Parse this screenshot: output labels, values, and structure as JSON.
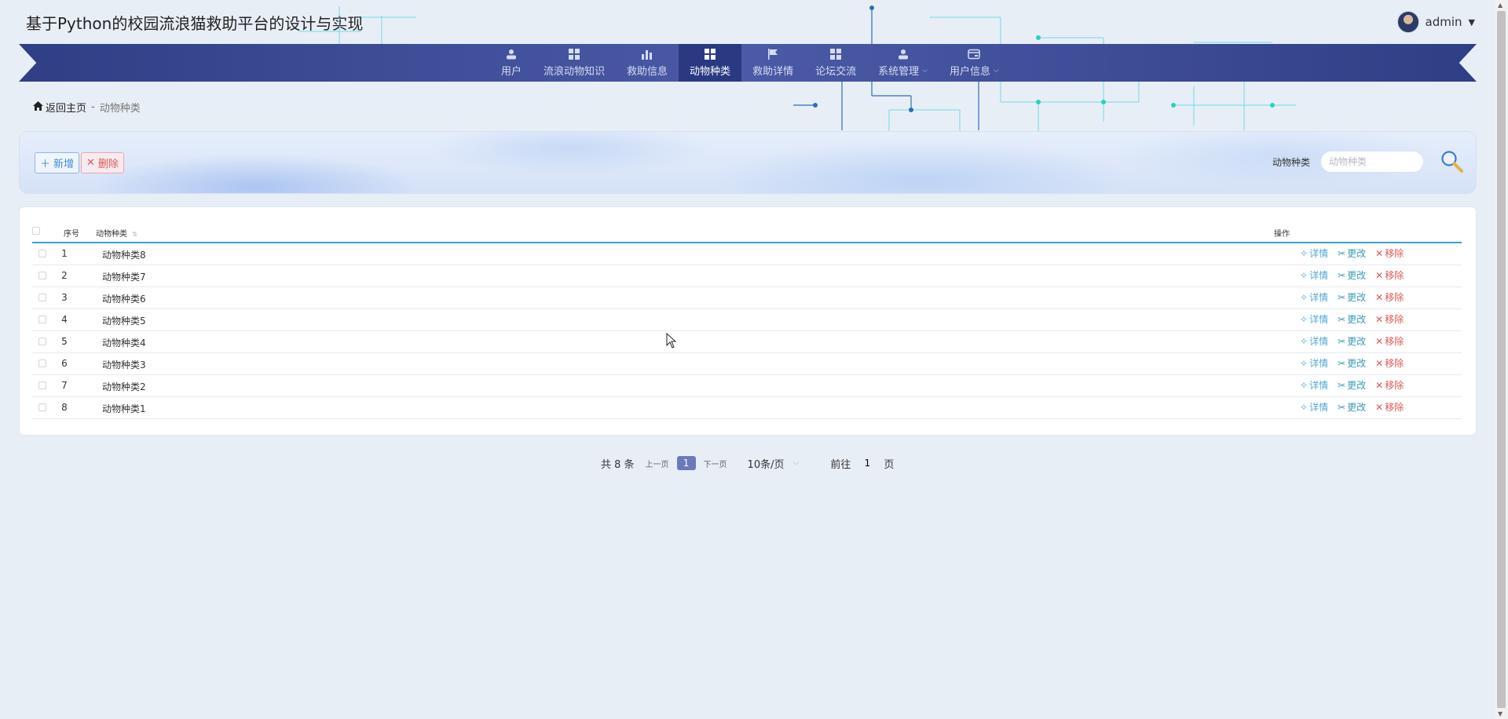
{
  "header": {
    "site_title": "基于Python的校园流浪猫救助平台的设计与实现",
    "username": "admin"
  },
  "nav": {
    "items": [
      {
        "label": "用户",
        "icon": "user-icon"
      },
      {
        "label": "流浪动物知识",
        "icon": "grid-icon"
      },
      {
        "label": "救助信息",
        "icon": "bar-chart-icon"
      },
      {
        "label": "动物种类",
        "icon": "grid-icon",
        "active": true
      },
      {
        "label": "救助详情",
        "icon": "flag-icon"
      },
      {
        "label": "论坛交流",
        "icon": "grid-icon"
      },
      {
        "label": "系统管理",
        "icon": "user-icon",
        "dropdown": true
      },
      {
        "label": "用户信息",
        "icon": "card-icon",
        "dropdown": true
      }
    ]
  },
  "breadcrumb": {
    "home": "返回主页",
    "separator": "-",
    "current": "动物种类"
  },
  "toolbar": {
    "add_label": "新增",
    "delete_label": "删除",
    "search_label": "动物种类",
    "search_placeholder": "动物种类"
  },
  "table": {
    "columns": {
      "index": "序号",
      "name": "动物种类",
      "actions": "操作"
    },
    "rows": [
      {
        "index": "1",
        "name": "动物种类8"
      },
      {
        "index": "2",
        "name": "动物种类7"
      },
      {
        "index": "3",
        "name": "动物种类6"
      },
      {
        "index": "4",
        "name": "动物种类5"
      },
      {
        "index": "5",
        "name": "动物种类4"
      },
      {
        "index": "6",
        "name": "动物种类3"
      },
      {
        "index": "7",
        "name": "动物种类2"
      },
      {
        "index": "8",
        "name": "动物种类1"
      }
    ],
    "actions": {
      "detail": "详情",
      "edit": "更改",
      "remove": "移除"
    }
  },
  "pagination": {
    "total": "共 8 条",
    "prev": "上一页",
    "current_page": "1",
    "next": "下一页",
    "page_size": "10条/页",
    "goto_label": "前往",
    "goto_value": "1",
    "page_suffix": "页"
  },
  "colors": {
    "nav_bg": "#3a4a96",
    "nav_active": "#2a3a82",
    "accent_line": "#3aa0c8",
    "add": "#3a8ee0",
    "delete": "#e25555",
    "pager_current": "#6c7ab8"
  }
}
